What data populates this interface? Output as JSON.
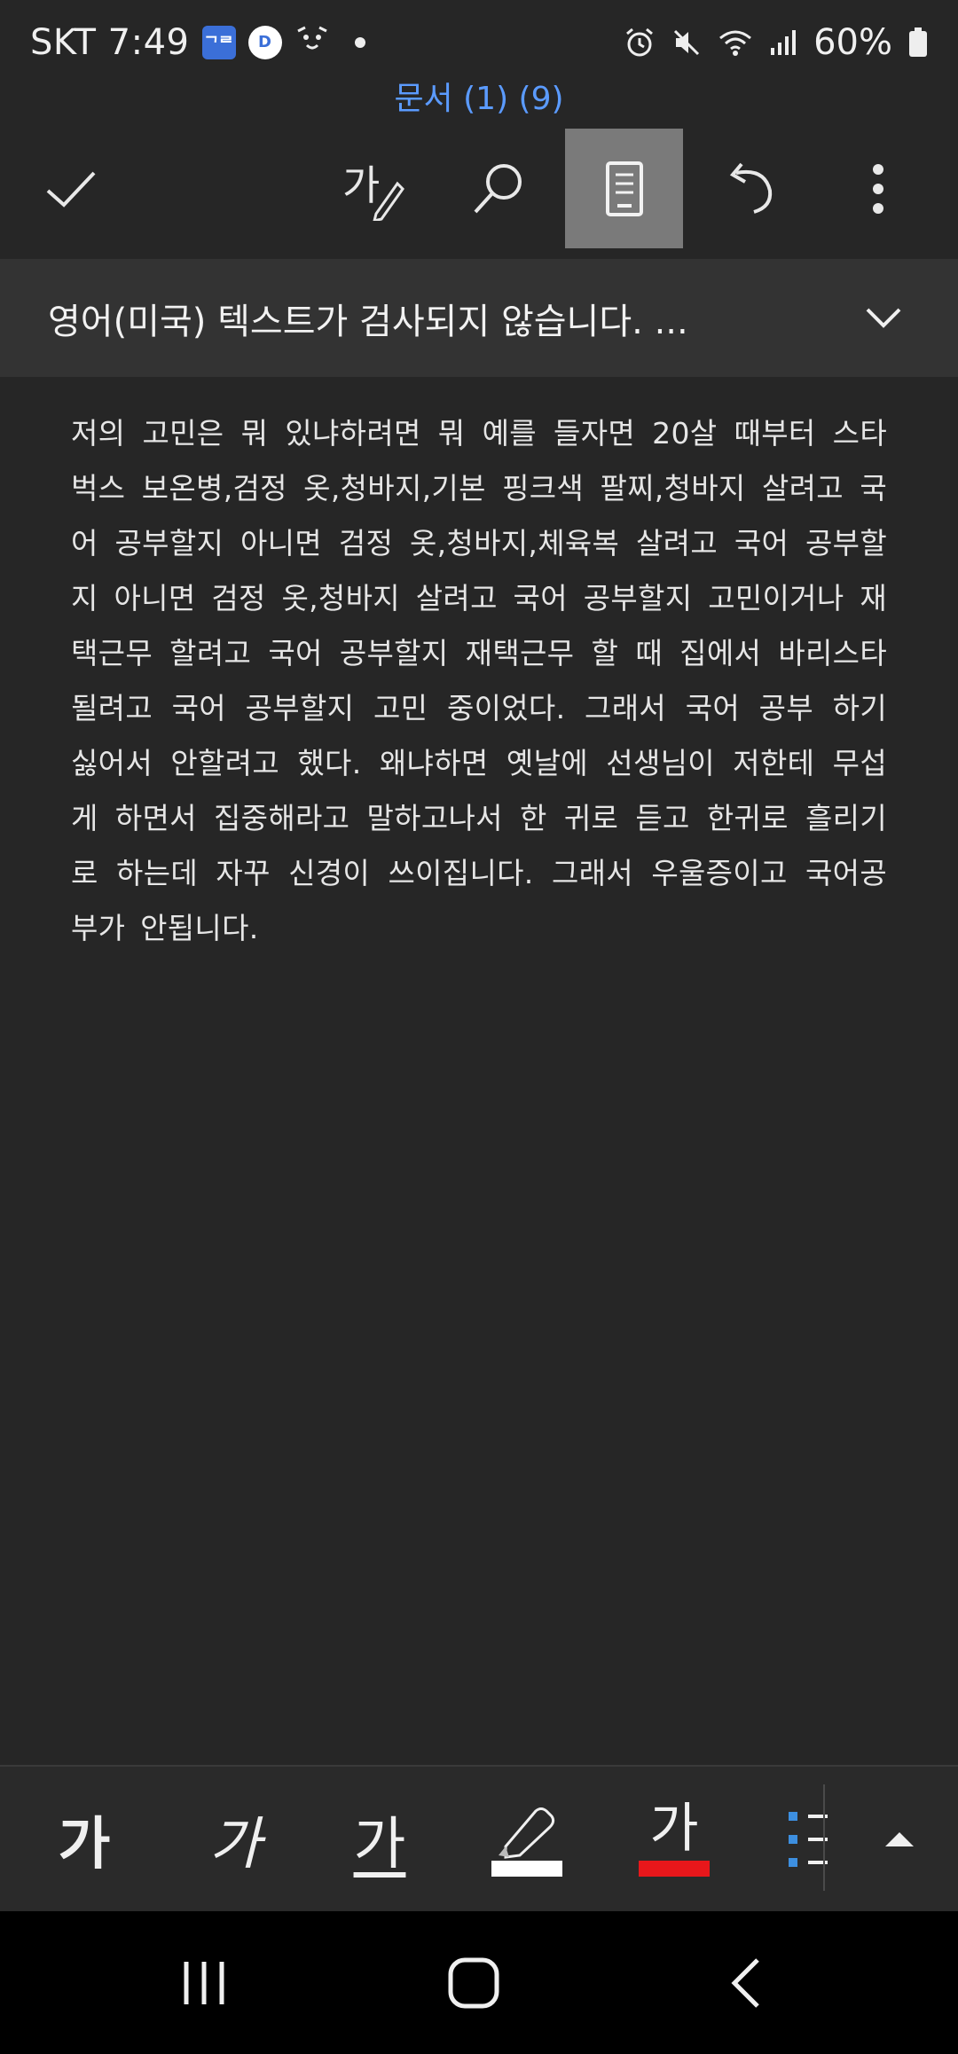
{
  "status_bar": {
    "carrier_time": "SKT 7:49",
    "app_icon_1_text": "ᄀᄅ",
    "app_icon_2_text": "D",
    "battery": "60%"
  },
  "document": {
    "title": "문서 (1) (9)"
  },
  "toolbar": {
    "done_icon": "check-icon",
    "draw_icon": "pen-text-icon",
    "search_icon": "search-icon",
    "mobile_view_icon": "mobile-view-icon",
    "undo_icon": "undo-icon",
    "more_icon": "more-vertical-icon"
  },
  "banner": {
    "message": "영어(미국) 텍스트가 검사되지 않습니다. ..."
  },
  "body": {
    "text": "저의 고민은 뭐 있냐하려면 뭐 예를 들자면 20살 때부터 스타벅스 보온병,검정 옷,청바지,기본 핑크색 팔찌,청바지 살려고 국어 공부할지 아니면 검정 옷,청바지,체육복 살려고 국어 공부할지 아니면 검정 옷,청바지 살려고 국어 공부할지 고민이거나 재택근무 할려고 국어 공부할지 재택근무 할 때 집에서 바리스타 될려고 국어 공부할지 고민 중이었다. 그래서 국어 공부 하기 싫어서 안할려고 했다. 왜냐하면 옛날에 선생님이 저한테 무섭게 하면서 집중해라고 말하고나서 한 귀로 듣고 한귀로 흘리기로 하는데 자꾸 신경이 쓰이집니다. 그래서 우울증이고 국어공부가 안됩니다."
  },
  "format_bar": {
    "bold_label": "가",
    "italic_label": "가",
    "underline_label": "가",
    "font_color_label": "가",
    "highlight_color": "#ffffff",
    "font_color": "#e8171b"
  },
  "colors": {
    "accent": "#5b9bff",
    "background": "#262626",
    "banner": "#333333"
  }
}
